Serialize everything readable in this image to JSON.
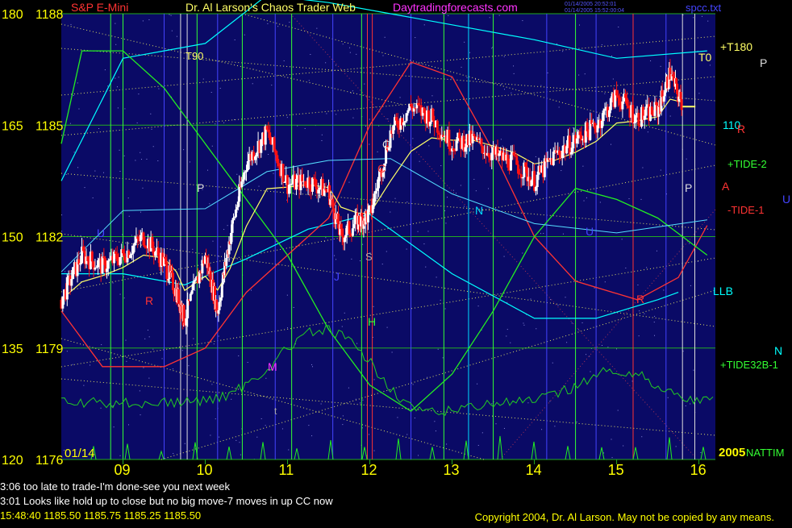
{
  "header": {
    "symbol": "S&P E-Mini",
    "title": "Dr. Al Larson's Chaos Trader Web",
    "site": "Daytradingforecasts.com",
    "stamp_line1": "01/14/2005 20:52:01",
    "stamp_line2": "01/14/2005 15:52:00:04",
    "file": "spcc.txt"
  },
  "colors": {
    "background": "#000000",
    "plot_bg": "#0a0a66",
    "price_up": "#ffffff",
    "price_down": "#ff0000",
    "yellow_text": "#ffff00",
    "gridline": "#33ff33",
    "cyan_band": "#00ffff",
    "red_line": "#ff0000",
    "green_line": "#33ff33"
  },
  "chart_data": {
    "type": "candlestick",
    "title": "S&P E-Mini",
    "date_label": "01/14",
    "year_label": "2005",
    "y_left_labels": [
      "120",
      "135",
      "150",
      "165",
      "180"
    ],
    "y_price_labels": [
      "1176",
      "1179",
      "1182",
      "1185",
      "1188"
    ],
    "ylim": [
      1176,
      1188
    ],
    "x_ticks": [
      "09",
      "10",
      "11",
      "12",
      "13",
      "14",
      "15",
      "16"
    ],
    "xlim": [
      8.25,
      16.2
    ],
    "last_price": 1185.5,
    "right_labels": [
      "+T180",
      "T0",
      "P",
      "110",
      "R",
      "+TIDE-2",
      "A",
      "U",
      "-TIDE-1",
      "LLB",
      "N",
      "+TIDE32B-1",
      "NATTIM"
    ],
    "chart_labels": [
      "T90",
      "U",
      "R",
      "P",
      "J",
      "M",
      "t",
      "O",
      "C",
      "S",
      "H",
      "N",
      "U",
      "R",
      "P"
    ],
    "price_series": [
      {
        "t": 8.25,
        "c": 1180.3
      },
      {
        "t": 8.5,
        "c": 1181.5
      },
      {
        "t": 8.75,
        "c": 1181.2
      },
      {
        "t": 9.0,
        "c": 1181.5
      },
      {
        "t": 9.25,
        "c": 1182.0
      },
      {
        "t": 9.5,
        "c": 1181.3
      },
      {
        "t": 9.65,
        "c": 1180.5
      },
      {
        "t": 9.75,
        "c": 1179.8
      },
      {
        "t": 10.0,
        "c": 1181.5
      },
      {
        "t": 10.15,
        "c": 1180.0
      },
      {
        "t": 10.3,
        "c": 1182.0
      },
      {
        "t": 10.5,
        "c": 1184.0
      },
      {
        "t": 10.75,
        "c": 1184.8
      },
      {
        "t": 11.0,
        "c": 1183.4
      },
      {
        "t": 11.25,
        "c": 1183.5
      },
      {
        "t": 11.5,
        "c": 1183.2
      },
      {
        "t": 11.65,
        "c": 1182.0
      },
      {
        "t": 11.85,
        "c": 1182.4
      },
      {
        "t": 12.0,
        "c": 1182.6
      },
      {
        "t": 12.25,
        "c": 1184.8
      },
      {
        "t": 12.5,
        "c": 1185.5
      },
      {
        "t": 12.75,
        "c": 1185.2
      },
      {
        "t": 13.0,
        "c": 1184.5
      },
      {
        "t": 13.25,
        "c": 1184.6
      },
      {
        "t": 13.5,
        "c": 1184.2
      },
      {
        "t": 13.75,
        "c": 1184.0
      },
      {
        "t": 14.0,
        "c": 1183.5
      },
      {
        "t": 14.25,
        "c": 1184.2
      },
      {
        "t": 14.5,
        "c": 1184.6
      },
      {
        "t": 14.75,
        "c": 1185.0
      },
      {
        "t": 15.0,
        "c": 1185.8
      },
      {
        "t": 15.25,
        "c": 1185.2
      },
      {
        "t": 15.5,
        "c": 1185.4
      },
      {
        "t": 15.65,
        "c": 1186.4
      },
      {
        "t": 15.8,
        "c": 1185.5
      }
    ],
    "red_cycle": [
      {
        "t": 8.25,
        "v": 1180.0
      },
      {
        "t": 8.75,
        "v": 1178.5
      },
      {
        "t": 9.5,
        "v": 1178.5
      },
      {
        "t": 10.0,
        "v": 1179.0
      },
      {
        "t": 10.5,
        "v": 1180.5
      },
      {
        "t": 11.0,
        "v": 1181.5
      },
      {
        "t": 11.5,
        "v": 1182.5
      },
      {
        "t": 12.0,
        "v": 1185.0
      },
      {
        "t": 12.5,
        "v": 1186.7
      },
      {
        "t": 13.0,
        "v": 1186.3
      },
      {
        "t": 13.5,
        "v": 1184.3
      },
      {
        "t": 14.0,
        "v": 1182.0
      },
      {
        "t": 14.5,
        "v": 1180.8
      },
      {
        "t": 15.25,
        "v": 1180.3
      },
      {
        "t": 15.75,
        "v": 1180.9
      },
      {
        "t": 16.1,
        "v": 1182.3
      }
    ],
    "green_cycle": [
      {
        "t": 8.25,
        "v": 1184.5
      },
      {
        "t": 8.5,
        "v": 1187.0
      },
      {
        "t": 9.0,
        "v": 1187.0
      },
      {
        "t": 9.5,
        "v": 1186.0
      },
      {
        "t": 10.0,
        "v": 1184.5
      },
      {
        "t": 10.5,
        "v": 1183.0
      },
      {
        "t": 11.0,
        "v": 1181.5
      },
      {
        "t": 11.5,
        "v": 1179.5
      },
      {
        "t": 12.0,
        "v": 1178.0
      },
      {
        "t": 12.5,
        "v": 1177.3
      },
      {
        "t": 13.0,
        "v": 1178.3
      },
      {
        "t": 13.5,
        "v": 1180.0
      },
      {
        "t": 14.0,
        "v": 1182.0
      },
      {
        "t": 14.5,
        "v": 1183.3
      },
      {
        "t": 15.0,
        "v": 1183.0
      },
      {
        "t": 15.5,
        "v": 1182.5
      },
      {
        "t": 16.1,
        "v": 1181.5
      }
    ],
    "upper_band": [
      {
        "t": 8.25,
        "v": 1183.5
      },
      {
        "t": 9.0,
        "v": 1186.8
      },
      {
        "t": 10.0,
        "v": 1187.2
      },
      {
        "t": 10.75,
        "v": 1188.5
      },
      {
        "t": 11.5,
        "v": 1188.3
      },
      {
        "t": 12.25,
        "v": 1188.0
      },
      {
        "t": 13.0,
        "v": 1187.7
      },
      {
        "t": 14.0,
        "v": 1187.3
      },
      {
        "t": 15.0,
        "v": 1186.8
      },
      {
        "t": 16.1,
        "v": 1187.0
      }
    ],
    "lower_band": [
      {
        "t": 8.25,
        "v": 1181.0
      },
      {
        "t": 9.0,
        "v": 1181.0
      },
      {
        "t": 9.75,
        "v": 1180.7
      },
      {
        "t": 10.5,
        "v": 1181.4
      },
      {
        "t": 11.25,
        "v": 1182.2
      },
      {
        "t": 12.0,
        "v": 1182.6
      },
      {
        "t": 13.0,
        "v": 1181.0
      },
      {
        "t": 14.0,
        "v": 1179.8
      },
      {
        "t": 14.75,
        "v": 1179.8
      },
      {
        "t": 15.5,
        "v": 1180.3
      },
      {
        "t": 15.75,
        "v": 1180.5
      }
    ]
  },
  "status": {
    "line1": "3:06 too late to trade-I'm done-see you next week",
    "line2": "3:01 Looks like hold up to close but no big move-7 moves in up CC now",
    "quote": "15:48:40  1185.50 1185.75 1185.25 1185.50",
    "copyright": "Copyright 2004, Dr. Al Larson. May not be copied by any means."
  }
}
